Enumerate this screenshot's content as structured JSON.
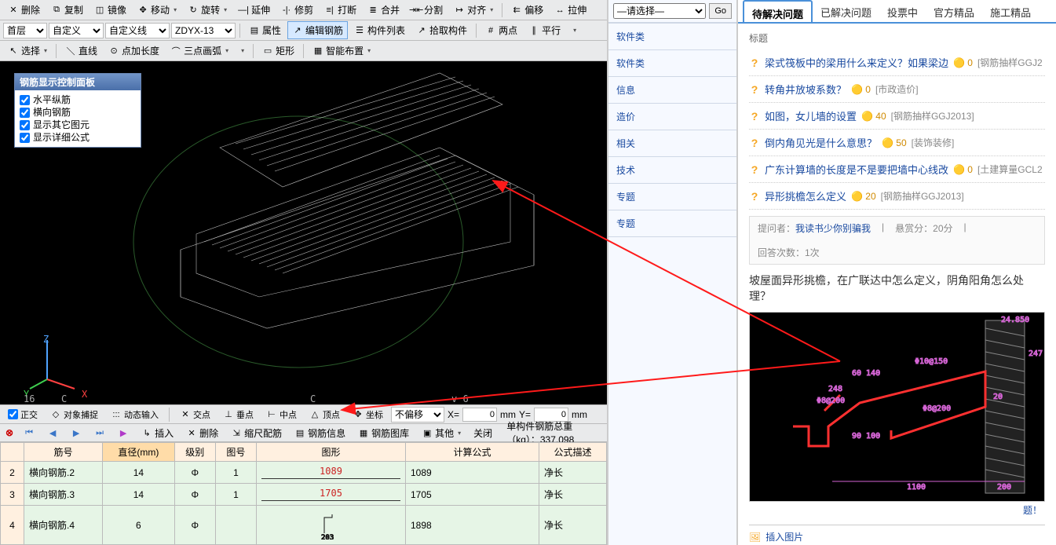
{
  "toolbar1": {
    "delete": "删除",
    "copy": "复制",
    "mirror": "镜像",
    "move": "移动",
    "rotate": "旋转",
    "extend": "延伸",
    "trim": "修剪",
    "break": "打断",
    "join": "合并",
    "split": "分割",
    "align": "对齐",
    "offset": "偏移",
    "stretch": "拉伸"
  },
  "toolbar2": {
    "floor": "首层",
    "custom": "自定义",
    "custom_line": "自定义线",
    "code": "ZDYX-13",
    "prop": "属性",
    "edit_rebar": "编辑钢筋",
    "comp_list": "构件列表",
    "pick_comp": "拾取构件",
    "two_pt": "两点",
    "parallel": "平行"
  },
  "toolbar3": {
    "select": "选择",
    "line": "直线",
    "pt_len": "点加长度",
    "arc3": "三点画弧",
    "rect": "矩形",
    "smart": "智能布置"
  },
  "ctrl": {
    "title": "钢筋显示控制面板",
    "items": [
      "水平纵筋",
      "横向钢筋",
      "显示其它图元",
      "显示详细公式"
    ]
  },
  "viewport": {
    "labels": [
      "Z",
      "Y",
      "X"
    ],
    "l16": "16",
    "lc": "C",
    "lc2": "C",
    "lv6": "v 6"
  },
  "statusbar": {
    "ortho": "正交",
    "osnap": "对象捕捉",
    "dyn": "动态输入",
    "int": "交点",
    "perp": "垂点",
    "mid": "中点",
    "apex": "顶点",
    "coord": "坐标",
    "nooffset": "不偏移",
    "X": "0",
    "Y": "0",
    "mm": "mm",
    "xl": "X=",
    "yl": "Y="
  },
  "tabletb": {
    "insert": "插入",
    "delete": "删除",
    "scale": "缩尺配筋",
    "info": "钢筋信息",
    "lib": "钢筋图库",
    "other": "其他",
    "close": "关闭",
    "total_label": "单构件钢筋总重（kg）：",
    "total_val": "337.098"
  },
  "table": {
    "headers": [
      "筋号",
      "直径(mm)",
      "级别",
      "图号",
      "图形",
      "计算公式",
      "公式描述"
    ],
    "rows": [
      {
        "idx": "2",
        "no": "横向钢筋.2",
        "dia": "14",
        "grade": "Φ",
        "fig": "1",
        "shape": "1089",
        "formula": "1089",
        "desc": "净长"
      },
      {
        "idx": "3",
        "no": "横向钢筋.3",
        "dia": "14",
        "grade": "Φ",
        "fig": "1",
        "shape": "1705",
        "formula": "1705",
        "desc": "净长"
      },
      {
        "idx": "4",
        "no": "横向钢筋.4",
        "dia": "6",
        "grade": "Φ",
        "fig": "",
        "shape": "203",
        "formula": "1898",
        "desc": "净长"
      }
    ]
  },
  "mid": {
    "select_placeholder": "—请选择—",
    "go": "Go",
    "items": [
      "软件类",
      "软件类",
      "信息",
      "造价",
      "相关",
      "技术",
      "专题",
      "专题"
    ]
  },
  "right": {
    "tabs": [
      "待解决问题",
      "已解决问题",
      "投票中",
      "官方精品",
      "施工精品"
    ],
    "title_label": "标题",
    "questions": [
      {
        "text": "梁式筏板中的梁用什么来定义？如果梁边",
        "count": "0",
        "tag": "[钢筋抽样GGJ2"
      },
      {
        "text": "转角井放坡系数？",
        "count": "0",
        "tag": "[市政造价]"
      },
      {
        "text": "如图，女儿墙的设置",
        "count": "40",
        "tag": "[钢筋抽样GGJ2013]"
      },
      {
        "text": "倒内角见光是什么意思？",
        "count": "50",
        "tag": "[装饰装修]"
      },
      {
        "text": "广东计算墙的长度是不是要把墙中心线改",
        "count": "0",
        "tag": "[土建算量GCL2"
      },
      {
        "text": "异形挑檐怎么定义",
        "count": "20",
        "tag": "[钢筋抽样GGJ2013]"
      }
    ],
    "meta": {
      "asker_label": "提问者：",
      "asker": "我读书少你别骗我",
      "bounty": "悬赏分：20分",
      "answers": "回答次数：1次"
    },
    "q_title": "坡屋面异形挑檐，在广联达中怎么定义，阴角阳角怎么处理？",
    "insert_pic": "插入图片",
    "drawing": {
      "d1": "24.850",
      "d2": "247",
      "d3": "60 140",
      "d4": "Φ10@150",
      "d5": "248",
      "d6": "Φ8@200",
      "d7": "90 100",
      "d8": "20",
      "d9": "Φ8@200",
      "d10": "1100",
      "d11": "200"
    },
    "ti": "题！"
  }
}
